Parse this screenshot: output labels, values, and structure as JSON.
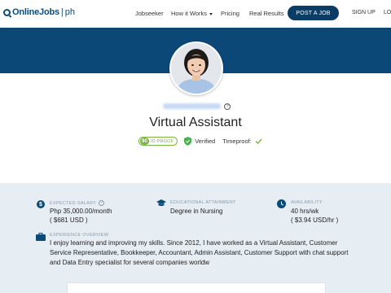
{
  "brand": {
    "name": "OnlineJobs",
    "suffix": "ph",
    "color": "#0a4b78"
  },
  "nav": {
    "jobseeker": "Jobseeker",
    "how_it_works": "How it Works",
    "pricing": "Pricing",
    "real_results": "Real Results",
    "post_job": "POST A JOB",
    "sign_up": "SIGN UP",
    "login": "LO"
  },
  "profile": {
    "title": "Virtual Assistant",
    "id_proof_score": "90",
    "id_proof_label": "ID PROOF",
    "verified_label": "Verified",
    "timeproof_label": "Timeproof:"
  },
  "stats": {
    "salary": {
      "label": "EXPECTED SALARY",
      "value": "Php 35,000.00/month",
      "sub": "( $681 USD )"
    },
    "education": {
      "label": "EDUCATIONAL ATTAINMENT",
      "value": "Degree in Nursing"
    },
    "availability": {
      "label": "AVAILABILITY",
      "value": "40 hrs/wk",
      "sub": "( $3.94 USD/hr )"
    },
    "experience": {
      "label": "EXPERIENCE OVERVIEW",
      "text": "I enjoy learning and improving my skills. Since 2012, I have worked as a Virtual Assistant, Customer Service Representative, Bookkeeper, Accountant, Admin Assistant, Customer Support with chat support and Data Entry specialist for several companies worldw"
    }
  },
  "colors": {
    "banner": "#0b4878",
    "accent_green": "#7cb342",
    "section_bg": "#e6edf3"
  }
}
